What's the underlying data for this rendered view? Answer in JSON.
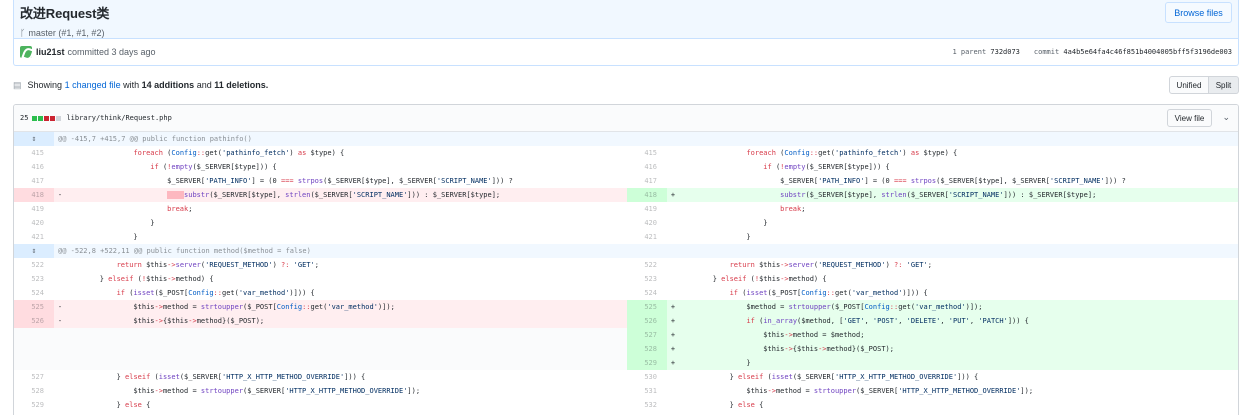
{
  "commit": {
    "title": "改进Request类",
    "branch": "master (#1, #1, #2)",
    "browse_files": "Browse files",
    "author": "liu21st",
    "committed": "committed 3 days ago",
    "parent_label": "1 parent",
    "parent_sha": "732d073",
    "commit_label": "commit",
    "commit_sha": "4a4b5e64fa4c46f851b4004005bff5f3196de003"
  },
  "toc": {
    "showing": "Showing",
    "changed": "1 changed file",
    "with": "with",
    "additions": "14 additions",
    "and": "and",
    "deletions": "11 deletions.",
    "unified": "Unified",
    "split": "Split"
  },
  "file": {
    "count": "25",
    "path": "library/think/Request.php",
    "view_file": "View file",
    "stat_blocks": [
      "add",
      "add",
      "del",
      "del",
      "neu"
    ]
  },
  "hunks": [
    {
      "header": "@@ -415,7 +415,7 @@ public function pathinfo()",
      "rows": [
        {
          "lnum": "415",
          "rnum": "415",
          "ltype": "ctx",
          "rtype": "ctx",
          "lsign": "",
          "rsign": "",
          "lcode": "                foreach (Config::get('pathinfo_fetch') as $type) {",
          "rcode": "                foreach (Config::get('pathinfo_fetch') as $type) {"
        },
        {
          "lnum": "416",
          "rnum": "416",
          "ltype": "ctx",
          "rtype": "ctx",
          "lsign": "",
          "rsign": "",
          "lcode": "                    if (!empty($_SERVER[$type])) {",
          "rcode": "                    if (!empty($_SERVER[$type])) {"
        },
        {
          "lnum": "417",
          "rnum": "417",
          "ltype": "ctx",
          "rtype": "ctx",
          "lsign": "",
          "rsign": "",
          "lcode": "                        $_SERVER['PATH_INFO'] = (0 === strpos($_SERVER[$type], $_SERVER['SCRIPT_NAME'])) ?",
          "rcode": "                        $_SERVER['PATH_INFO'] = (0 === strpos($_SERVER[$type], $_SERVER['SCRIPT_NAME'])) ?"
        },
        {
          "lnum": "418",
          "rnum": "418",
          "ltype": "del",
          "rtype": "add",
          "lsign": "-",
          "rsign": "+",
          "lcode": "                        ····substr($_SERVER[$type], strlen($_SERVER['SCRIPT_NAME'])) : $_SERVER[$type];",
          "rcode": "                        substr($_SERVER[$type], strlen($_SERVER['SCRIPT_NAME'])) : $_SERVER[$type];"
        },
        {
          "lnum": "419",
          "rnum": "419",
          "ltype": "ctx",
          "rtype": "ctx",
          "lsign": "",
          "rsign": "",
          "lcode": "                        break;",
          "rcode": "                        break;"
        },
        {
          "lnum": "420",
          "rnum": "420",
          "ltype": "ctx",
          "rtype": "ctx",
          "lsign": "",
          "rsign": "",
          "lcode": "                    }",
          "rcode": "                    }"
        },
        {
          "lnum": "421",
          "rnum": "421",
          "ltype": "ctx",
          "rtype": "ctx",
          "lsign": "",
          "rsign": "",
          "lcode": "                }",
          "rcode": "                }"
        }
      ]
    },
    {
      "header": "@@ -522,8 +522,11 @@ public function method($method = false)",
      "rows": [
        {
          "lnum": "522",
          "rnum": "522",
          "ltype": "ctx",
          "rtype": "ctx",
          "lsign": "",
          "rsign": "",
          "lcode": "            return $this->server('REQUEST_METHOD') ?: 'GET';",
          "rcode": "            return $this->server('REQUEST_METHOD') ?: 'GET';"
        },
        {
          "lnum": "523",
          "rnum": "523",
          "ltype": "ctx",
          "rtype": "ctx",
          "lsign": "",
          "rsign": "",
          "lcode": "        } elseif (!$this->method) {",
          "rcode": "        } elseif (!$this->method) {"
        },
        {
          "lnum": "524",
          "rnum": "524",
          "ltype": "ctx",
          "rtype": "ctx",
          "lsign": "",
          "rsign": "",
          "lcode": "            if (isset($_POST[Config::get('var_method')])) {",
          "rcode": "            if (isset($_POST[Config::get('var_method')])) {"
        },
        {
          "lnum": "525",
          "rnum": "525",
          "ltype": "del",
          "rtype": "add",
          "lsign": "-",
          "rsign": "+",
          "lcode": "                $this->method = strtoupper($_POST[Config::get('var_method')]);",
          "rcode": "                $method = strtoupper($_POST[Config::get('var_method')]);"
        },
        {
          "lnum": "526",
          "rnum": "526",
          "ltype": "del",
          "rtype": "add",
          "lsign": "-",
          "rsign": "+",
          "lcode": "                $this->{$this->method}($_POST);",
          "rcode": "                if (in_array($method, ['GET', 'POST', 'DELETE', 'PUT', 'PATCH'])) {"
        },
        {
          "lnum": "",
          "rnum": "527",
          "ltype": "empty",
          "rtype": "add",
          "lsign": "",
          "rsign": "+",
          "lcode": "",
          "rcode": "                    $this->method = $method;"
        },
        {
          "lnum": "",
          "rnum": "528",
          "ltype": "empty",
          "rtype": "add",
          "lsign": "",
          "rsign": "+",
          "lcode": "",
          "rcode": "                    $this->{$this->method}($_POST);"
        },
        {
          "lnum": "",
          "rnum": "529",
          "ltype": "empty",
          "rtype": "add",
          "lsign": "",
          "rsign": "+",
          "lcode": "",
          "rcode": "                }"
        },
        {
          "lnum": "527",
          "rnum": "530",
          "ltype": "ctx",
          "rtype": "ctx",
          "lsign": "",
          "rsign": "",
          "lcode": "            } elseif (isset($_SERVER['HTTP_X_HTTP_METHOD_OVERRIDE'])) {",
          "rcode": "            } elseif (isset($_SERVER['HTTP_X_HTTP_METHOD_OVERRIDE'])) {"
        },
        {
          "lnum": "528",
          "rnum": "531",
          "ltype": "ctx",
          "rtype": "ctx",
          "lsign": "",
          "rsign": "",
          "lcode": "                $this->method = strtoupper($_SERVER['HTTP_X_HTTP_METHOD_OVERRIDE']);",
          "rcode": "                $this->method = strtoupper($_SERVER['HTTP_X_HTTP_METHOD_OVERRIDE']);"
        },
        {
          "lnum": "529",
          "rnum": "532",
          "ltype": "ctx",
          "rtype": "ctx",
          "lsign": "",
          "rsign": "",
          "lcode": "            } else {",
          "rcode": "            } else {"
        }
      ]
    }
  ],
  "colors": {
    "add_bg": "#e6ffed",
    "add_num_bg": "#cdffd8",
    "del_bg": "#ffeef0",
    "del_num_bg": "#ffdce0",
    "hunk_bg": "#f1f8ff",
    "link": "#0366d6"
  }
}
